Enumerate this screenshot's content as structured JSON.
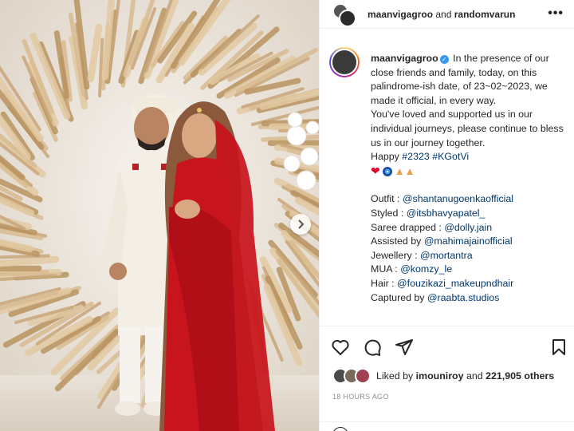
{
  "post_header": {
    "user1": "maanvigagroo",
    "and": "and",
    "user2": "randomvarun",
    "more_icon": "more-horizontal-icon"
  },
  "caption": {
    "username": "maanvigagroo",
    "verified_icon": "verified-badge-icon",
    "paragraph1": "In the presence of our close friends and family, today, on this palindrome-ish date, of 23~02~2023, we made it official, in every way.",
    "paragraph2": "You've loved and supported us in our individual journeys, please continue to bless us in our journey together.",
    "happy": "Happy",
    "hashtag1": "#2323",
    "hashtag2": "#KGotVi",
    "emojis": [
      "heart-icon",
      "evil-eye-icon",
      "folded-hands-icon"
    ],
    "credits": [
      {
        "label": "Outfit : ",
        "handle": "@shantanugoenkaofficial"
      },
      {
        "label": "Styled : ",
        "handle": "@itsbhavyapatel_"
      },
      {
        "label": "Saree drapped : ",
        "handle": "@dolly.jain"
      },
      {
        "label": "Assisted by ",
        "handle": "@mahimajainofficial"
      },
      {
        "label": "Jewellery : ",
        "handle": "@mortantra"
      },
      {
        "label": "MUA : ",
        "handle": "@komzy_le"
      },
      {
        "label": "Hair : ",
        "handle": "@fouzikazi_makeupndhair"
      },
      {
        "label": "Captured by ",
        "handle": "@raabta.studios"
      }
    ]
  },
  "actions": {
    "like_icon": "heart-outline-icon",
    "comment_icon": "comment-icon",
    "share_icon": "paper-plane-icon",
    "save_icon": "bookmark-icon"
  },
  "likes": {
    "prefix": "Liked by",
    "user": "imouniroy",
    "middle": "and",
    "count": "221,905 others"
  },
  "timestamp": "18 HOURS AGO",
  "photo": {
    "next_icon": "chevron-right-icon"
  },
  "colors": {
    "link": "#00376b",
    "verified": "#3897f0",
    "saree": "#c8141c",
    "muted": "#8e8e8e"
  }
}
